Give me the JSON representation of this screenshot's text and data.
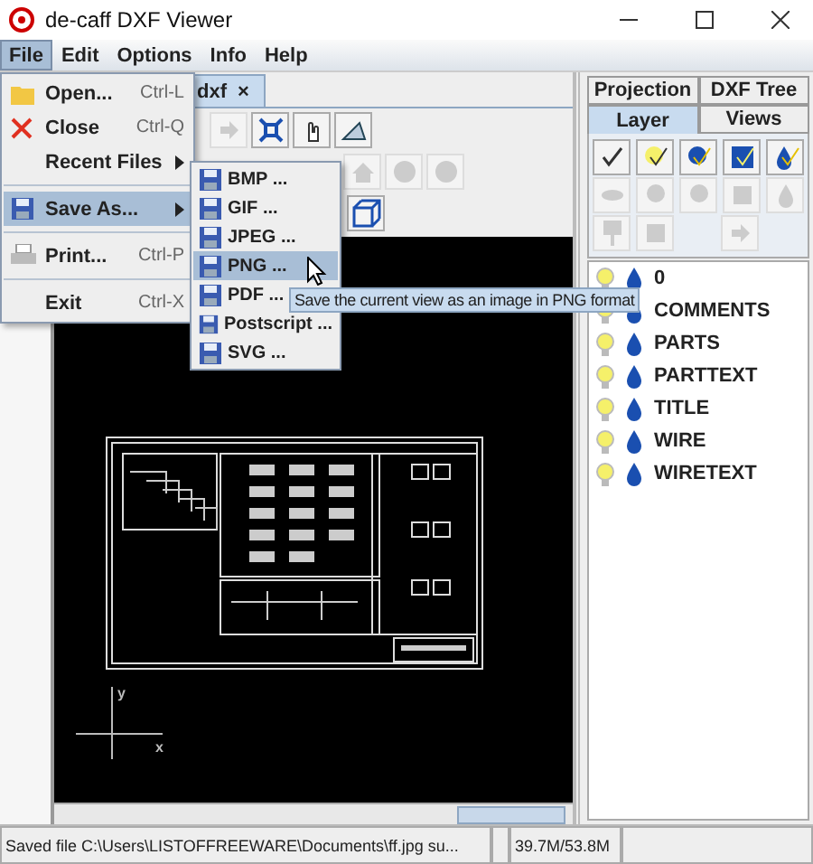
{
  "window": {
    "title": "de-caff DXF Viewer"
  },
  "menubar": [
    {
      "label": "File",
      "selected": true
    },
    {
      "label": "Edit",
      "selected": false
    },
    {
      "label": "Options",
      "selected": false
    },
    {
      "label": "Info",
      "selected": false
    },
    {
      "label": "Help",
      "selected": false
    }
  ],
  "file_menu": [
    {
      "kind": "item",
      "label": "Open...",
      "shortcut": "Ctrl-L",
      "selected": false
    },
    {
      "kind": "item",
      "label": "Close",
      "shortcut": "Ctrl-Q",
      "selected": false
    },
    {
      "kind": "submenu",
      "label": "Recent Files",
      "selected": false
    },
    {
      "kind": "separator"
    },
    {
      "kind": "submenu",
      "label": "Save As...",
      "selected": true
    },
    {
      "kind": "separator"
    },
    {
      "kind": "item",
      "label": "Print...",
      "shortcut": "Ctrl-P",
      "selected": false
    },
    {
      "kind": "separator"
    },
    {
      "kind": "item",
      "label": "Exit",
      "shortcut": "Ctrl-X",
      "selected": false
    }
  ],
  "save_as_menu": [
    {
      "label": "BMP ...",
      "selected": false
    },
    {
      "label": "GIF ...",
      "selected": false
    },
    {
      "label": "JPEG ...",
      "selected": false
    },
    {
      "label": "PNG ...",
      "selected": true
    },
    {
      "label": "PDF ...",
      "selected": false
    },
    {
      "label": "Postscript ...",
      "selected": false
    },
    {
      "label": "SVG ...",
      "selected": false
    }
  ],
  "tooltip": "Save the current view as an image in PNG format",
  "document_tab": {
    "label": "dxf",
    "close": "×"
  },
  "axes": {
    "y": "y",
    "x": "x"
  },
  "side_tabs_top": [
    {
      "label": "Projection",
      "selected": false
    },
    {
      "label": "DXF Tree",
      "selected": false
    }
  ],
  "side_tabs": [
    {
      "label": "Layer",
      "selected": true
    },
    {
      "label": "Views",
      "selected": false
    }
  ],
  "layers": [
    {
      "name": "0",
      "visible": true
    },
    {
      "name": "COMMENTS",
      "visible": true
    },
    {
      "name": "PARTS",
      "visible": true
    },
    {
      "name": "PARTTEXT",
      "visible": true
    },
    {
      "name": "TITLE",
      "visible": true
    },
    {
      "name": "WIRE",
      "visible": true
    },
    {
      "name": "WIRETEXT",
      "visible": true
    }
  ],
  "status_bar": {
    "message": "Saved file C:\\Users\\LISTOFFREEWARE\\Documents\\ff.jpg su...",
    "memory": "39.7M/53.8M"
  }
}
